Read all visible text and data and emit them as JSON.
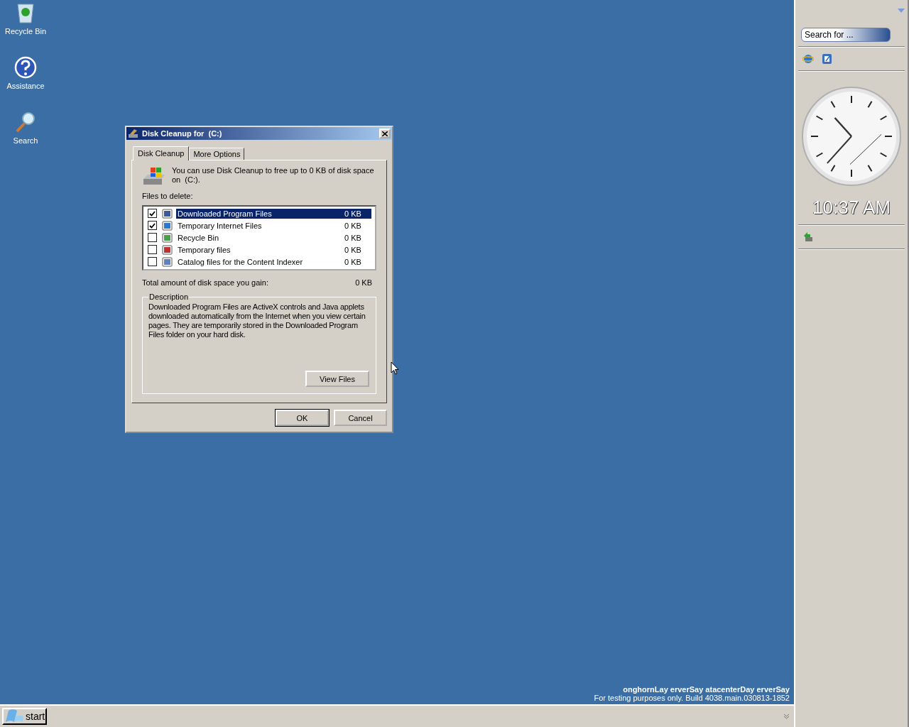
{
  "desktop": {
    "icons": [
      {
        "label": "Recycle Bin",
        "kind": "recycle"
      },
      {
        "label": "Assistance",
        "kind": "help"
      },
      {
        "label": "Search",
        "kind": "search"
      }
    ]
  },
  "dialog": {
    "title": "Disk Cleanup for  (C:)",
    "tabs": [
      {
        "label": "Disk Cleanup",
        "selected": true
      },
      {
        "label": "More Options",
        "selected": false
      }
    ],
    "intro": "You can use Disk Cleanup to free up to 0 KB of disk space on  (C:).",
    "files_label": "Files to delete:",
    "files": [
      {
        "name": "Downloaded Program Files",
        "size": "0 KB",
        "checked": true,
        "selected": true,
        "kind": "folder"
      },
      {
        "name": "Temporary Internet Files",
        "size": "0 KB",
        "checked": true,
        "selected": false,
        "kind": "web"
      },
      {
        "name": "Recycle Bin",
        "size": "0 KB",
        "checked": false,
        "selected": false,
        "kind": "recycle"
      },
      {
        "name": "Temporary files",
        "size": "0 KB",
        "checked": false,
        "selected": false,
        "kind": "document"
      },
      {
        "name": "Catalog files for the Content Indexer",
        "size": "0 KB",
        "checked": false,
        "selected": false,
        "kind": "catalog"
      }
    ],
    "total_label": "Total amount of disk space you gain:",
    "total_value": "0 KB",
    "description_title": "Description",
    "description": "Downloaded Program Files are ActiveX controls and Java applets downloaded automatically from the Internet when you view certain pages. They are temporarily stored in the Downloaded Program Files folder on your hard disk.",
    "view_files": "View Files",
    "buttons": [
      "OK",
      "Cancel"
    ]
  },
  "build": {
    "title": "onghornLay erverSay atacenterDay erverSay",
    "subtitle": "For testing purposes only. Build 4038.main.030813-1852"
  },
  "taskbar": {
    "start": "start"
  },
  "sidebar": {
    "search": {
      "placeholder": "Search for ..."
    },
    "time": "10:37 AM"
  }
}
